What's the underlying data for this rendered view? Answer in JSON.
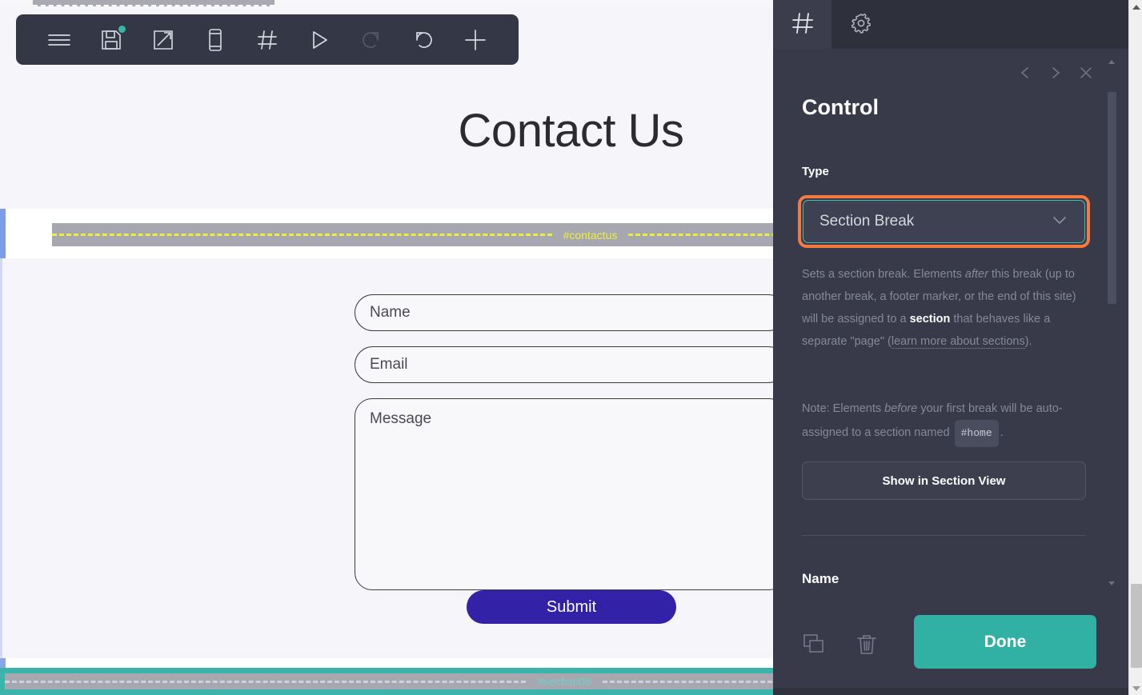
{
  "toolbar": {
    "items": [
      {
        "name": "menu-icon",
        "label": "Menu",
        "badge": false,
        "dim": false
      },
      {
        "name": "save-icon",
        "label": "Save",
        "badge": true,
        "dim": false
      },
      {
        "name": "preview-icon",
        "label": "Preview",
        "badge": false,
        "dim": false
      },
      {
        "name": "mobile-view-icon",
        "label": "Mobile",
        "badge": false,
        "dim": false
      },
      {
        "name": "section-icon",
        "label": "Sections",
        "badge": false,
        "dim": false
      },
      {
        "name": "play-icon",
        "label": "Play",
        "badge": false,
        "dim": false
      },
      {
        "name": "redo-icon",
        "label": "Redo",
        "badge": false,
        "dim": true
      },
      {
        "name": "undo-icon",
        "label": "Undo",
        "badge": false,
        "dim": false
      },
      {
        "name": "add-icon",
        "label": "Add",
        "badge": false,
        "dim": false
      }
    ]
  },
  "canvas": {
    "hero_title": "Contact Us",
    "form": {
      "name_placeholder": "Name",
      "email_placeholder": "Email",
      "message_placeholder": "Message",
      "submit_label": "Submit"
    },
    "markers": [
      {
        "id": "contactus",
        "label": "#contactus",
        "color": "#eded3d",
        "band": "#a7a7b1"
      },
      {
        "id": "section08",
        "label": "#section08",
        "color": "#6fd0c6",
        "band": "#3bb5ac"
      }
    ]
  },
  "panel": {
    "tabs": [
      {
        "id": "sections",
        "icon": "hash-icon",
        "active": true
      },
      {
        "id": "settings",
        "icon": "gear-icon",
        "active": false
      }
    ],
    "nav": {
      "prev": "chevron-left-icon",
      "next": "chevron-right-icon",
      "close": "close-icon"
    },
    "title": "Control",
    "type_label": "Type",
    "type_value": "Section Break",
    "type_options": [
      "Section Break"
    ],
    "description": {
      "p1_a": "Sets a section break. Elements ",
      "p1_em": "after",
      "p1_b": " this break (up to another break, a footer marker, or the end of this site) will be assigned to a ",
      "p1_strong": "section",
      "p1_c": " that behaves like a separate \"page\" (",
      "p1_link": "learn more about sections",
      "p1_d": ")."
    },
    "note": {
      "n_a": "Note: Elements ",
      "n_em": "before",
      "n_b": " your first break will be auto-assigned to a section named ",
      "n_code": "#home",
      "n_c": "."
    },
    "section_view_label": "Show in Section View",
    "name_label": "Name",
    "footer": {
      "duplicate_icon": "copy-icon",
      "delete_icon": "trash-icon",
      "done_label": "Done"
    }
  },
  "colors": {
    "panel_bg": "#383a49",
    "tabbar_bg": "#2e303c",
    "accent_teal": "#31b0a4",
    "highlight_orange": "#f47a42",
    "select_border_teal": "#46bfae",
    "submit_violet": "#3321a8",
    "marker_yellow": "#eded3d",
    "marker_teal": "#3bb5ac"
  }
}
